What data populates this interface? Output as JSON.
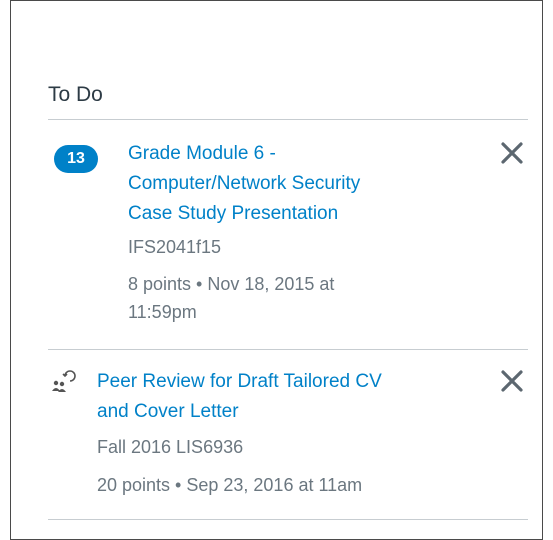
{
  "todo": {
    "title": "To Do",
    "items": [
      {
        "badge": "13",
        "title_lines": [
          "Grade Module 6 -",
          "Computer/Network Security",
          "Case Study Presentation"
        ],
        "course": "IFS2041f15",
        "details_lines": [
          "8 points • Nov 18, 2015 at",
          "11:59pm"
        ],
        "dismiss_icon": "close-icon"
      },
      {
        "type_icon": "peer-review-icon",
        "title_lines": [
          "Peer Review for Draft Tailored CV",
          "and Cover Letter"
        ],
        "course": "Fall 2016 LIS6936",
        "details": "20 points • Sep 23, 2016 at 11am",
        "dismiss_icon": "close-icon"
      }
    ]
  },
  "colors": {
    "link": "#0081c8",
    "badge_bg": "#0081c8",
    "muted_text": "#6b7780",
    "heading": "#2d3b45",
    "divider": "#c7cdd1",
    "dismiss": "#5c6770"
  }
}
